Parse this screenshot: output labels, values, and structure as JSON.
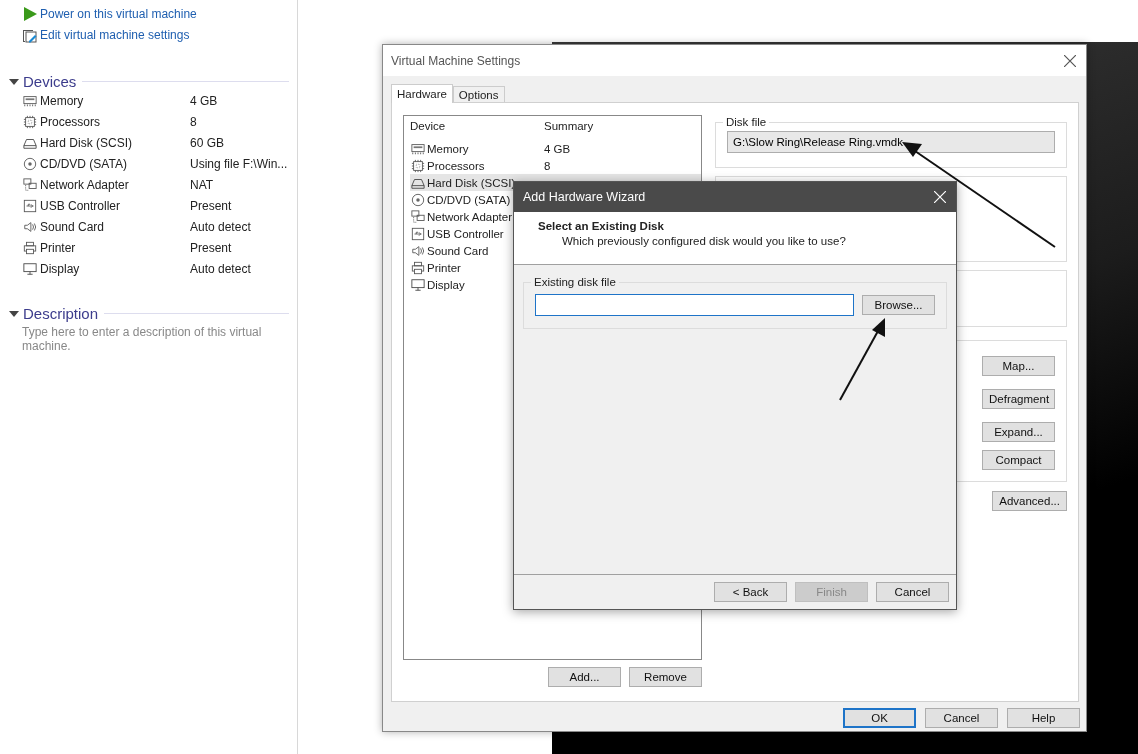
{
  "sidebar": {
    "actions": [
      {
        "kind": "power",
        "label": "Power on this virtual machine"
      },
      {
        "kind": "edit",
        "label": "Edit virtual machine settings"
      }
    ],
    "devices": {
      "title": "Devices",
      "expanded": true,
      "items": [
        {
          "kind": "memory",
          "name": "Memory",
          "value": "4 GB"
        },
        {
          "kind": "processor",
          "name": "Processors",
          "value": "8"
        },
        {
          "kind": "disk",
          "name": "Hard Disk (SCSI)",
          "value": "60 GB"
        },
        {
          "kind": "cd",
          "name": "CD/DVD (SATA)",
          "value": "Using file F:\\Win..."
        },
        {
          "kind": "network",
          "name": "Network Adapter",
          "value": "NAT"
        },
        {
          "kind": "usb",
          "name": "USB Controller",
          "value": "Present"
        },
        {
          "kind": "sound",
          "name": "Sound Card",
          "value": "Auto detect"
        },
        {
          "kind": "printer",
          "name": "Printer",
          "value": "Present"
        },
        {
          "kind": "display",
          "name": "Display",
          "value": "Auto detect"
        }
      ]
    },
    "description": {
      "title": "Description",
      "expanded": true,
      "placeholder": "Type here to enter a description of this virtual machine."
    }
  },
  "settings_window": {
    "title": "Virtual Machine Settings",
    "tabs": [
      {
        "label": "Hardware",
        "selected": true
      },
      {
        "label": "Options",
        "selected": false
      }
    ],
    "device_list": {
      "columns": [
        "Device",
        "Summary"
      ],
      "rows": [
        {
          "kind": "memory",
          "name": "Memory",
          "summary": "4 GB",
          "selected": false
        },
        {
          "kind": "processor",
          "name": "Processors",
          "summary": "8",
          "selected": false
        },
        {
          "kind": "disk",
          "name": "Hard Disk (SCSI)",
          "selected": true
        },
        {
          "kind": "cd",
          "name": "CD/DVD (SATA)",
          "selected": false
        },
        {
          "kind": "network",
          "name": "Network Adapter",
          "selected": false
        },
        {
          "kind": "usb",
          "name": "USB Controller",
          "selected": false
        },
        {
          "kind": "sound",
          "name": "Sound Card",
          "selected": false
        },
        {
          "kind": "printer",
          "name": "Printer",
          "selected": false
        },
        {
          "kind": "display",
          "name": "Display",
          "selected": false
        }
      ]
    },
    "list_buttons": [
      "Add...",
      "Remove"
    ],
    "disk_file": {
      "label": "Disk file",
      "value": "G:\\Slow Ring\\Release Ring.vmdk"
    },
    "disk_buttons": [
      "Map...",
      "Defragment",
      "Expand...",
      "Compact"
    ],
    "advanced_button": "Advanced...",
    "buttons": [
      {
        "label": "OK",
        "default": true
      },
      {
        "label": "Cancel",
        "default": false
      },
      {
        "label": "Help",
        "default": false
      }
    ]
  },
  "wizard": {
    "title": "Add Hardware Wizard",
    "heading": "Select an Existing Disk",
    "subtitle": "Which previously configured disk would you like to use?",
    "file_group": {
      "label": "Existing disk file"
    },
    "browse_button": "Browse...",
    "buttons": [
      {
        "label": "< Back",
        "disabled": false
      },
      {
        "label": "Finish",
        "disabled": true
      },
      {
        "label": "Cancel",
        "disabled": false
      }
    ]
  }
}
